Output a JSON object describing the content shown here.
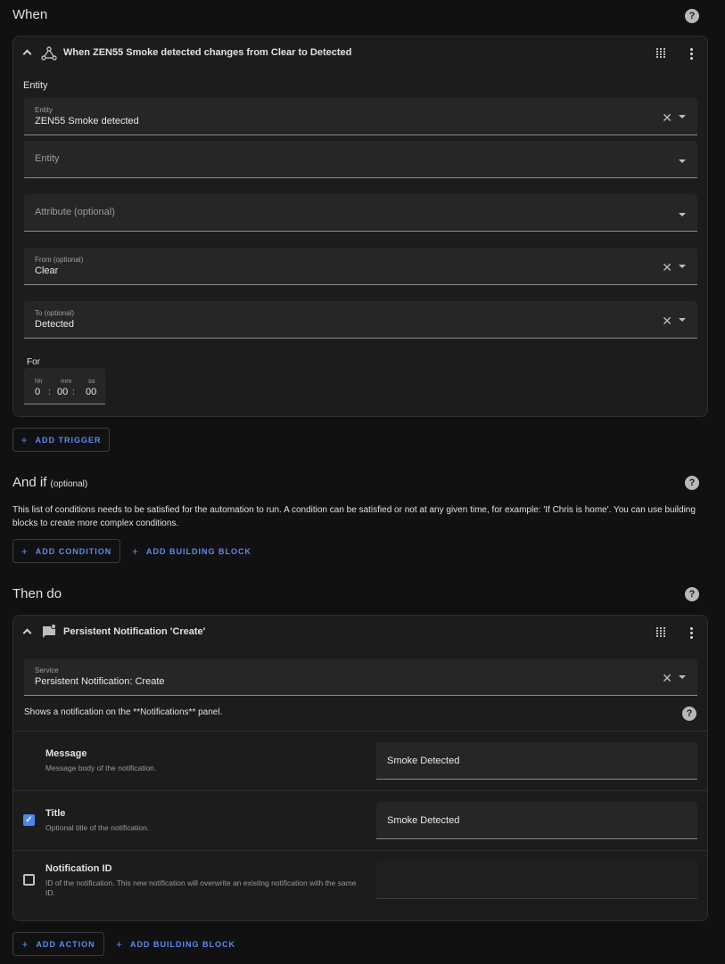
{
  "when": {
    "title": "When",
    "trigger": {
      "header": "When ZEN55 Smoke detected changes from Clear to Detected",
      "entity_section_label": "Entity",
      "entity_field": {
        "label": "Entity",
        "value": "ZEN55 Smoke detected"
      },
      "entity_field_empty": {
        "label": "Entity"
      },
      "attribute_field": {
        "label": "Attribute (optional)"
      },
      "from_field": {
        "label": "From (optional)",
        "value": "Clear"
      },
      "to_field": {
        "label": "To (optional)",
        "value": "Detected"
      },
      "for_label": "For",
      "duration": {
        "hh_label": "hh",
        "mm_label": "mm",
        "ss_label": "ss",
        "hh": "0",
        "mm": "00",
        "ss": "00",
        "sep": ":"
      }
    },
    "add_trigger": "ADD TRIGGER"
  },
  "and_if": {
    "title": "And if",
    "optional": "(optional)",
    "description": "This list of conditions needs to be satisfied for the automation to run. A condition can be satisfied or not at any given time, for example: 'If Chris is home'. You can use building blocks to create more complex conditions.",
    "add_condition": "ADD CONDITION",
    "add_building_block": "ADD BUILDING BLOCK"
  },
  "then_do": {
    "title": "Then do",
    "action": {
      "header": "Persistent Notification 'Create'",
      "service_field": {
        "label": "Service",
        "value": "Persistent Notification: Create"
      },
      "service_description": "Shows a notification on the **Notifications** panel.",
      "params": [
        {
          "title": "Message",
          "description": "Message body of the notification.",
          "value": "Smoke Detected"
        },
        {
          "title": "Title",
          "description": "Optional title of the notification.",
          "value": "Smoke Detected",
          "checked": true
        },
        {
          "title": "Notification ID",
          "description": "ID of the notification. This new notification will overwrite an existing notification with the same ID.",
          "value": "",
          "checked": false
        }
      ]
    },
    "add_action": "ADD ACTION",
    "add_building_block": "ADD BUILDING BLOCK"
  },
  "icons": {
    "help": "?",
    "clear": "✕",
    "check": "✓",
    "plus": "+"
  },
  "colors": {
    "accent": "#5b8bf0",
    "background": "#111111",
    "card": "#1c1c1c",
    "field": "#262626"
  }
}
